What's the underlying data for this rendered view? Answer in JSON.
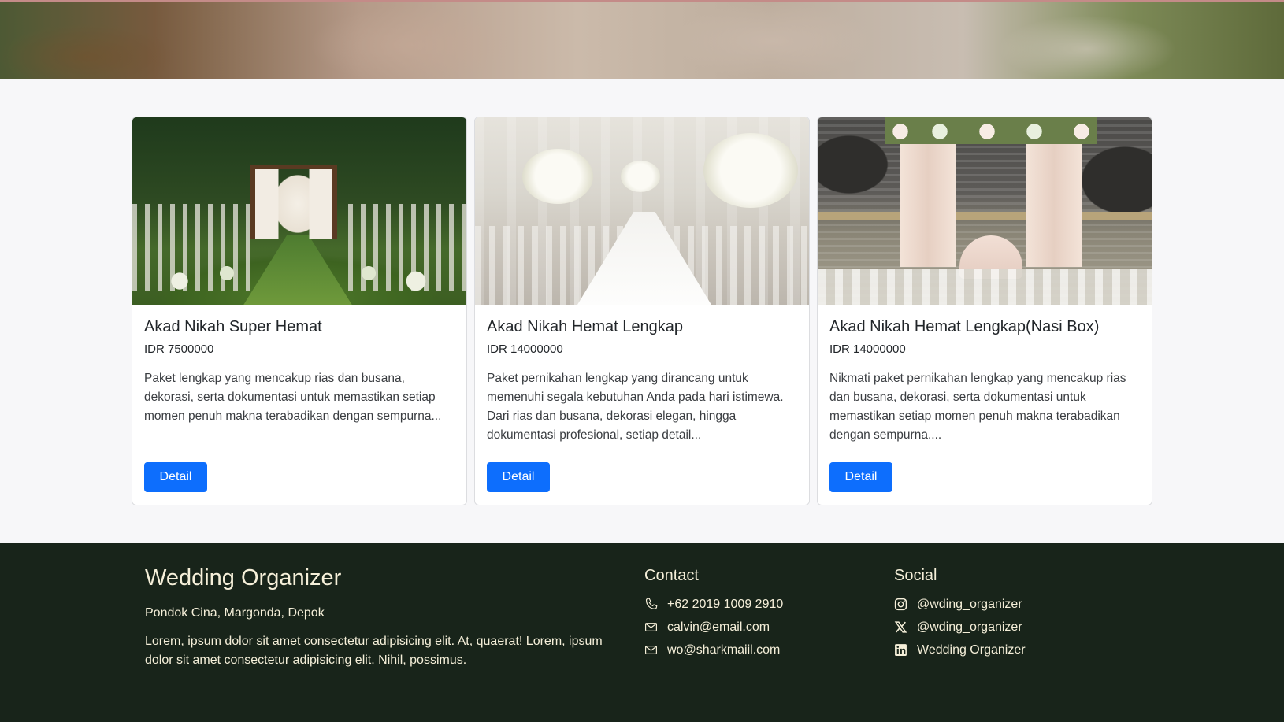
{
  "cards": [
    {
      "title": "Akad Nikah Super Hemat",
      "price": "IDR 7500000",
      "description": "Paket lengkap yang mencakup rias dan busana, dekorasi, serta dokumentasi untuk memastikan setiap momen penuh makna terabadikan dengan sempurna...",
      "button": "Detail"
    },
    {
      "title": "Akad Nikah Hemat Lengkap",
      "price": "IDR 14000000",
      "description": "Paket pernikahan lengkap yang dirancang untuk memenuhi segala kebutuhan Anda pada hari istimewa. Dari rias dan busana, dekorasi elegan, hingga dokumentasi profesional, setiap detail...",
      "button": "Detail"
    },
    {
      "title": "Akad Nikah Hemat Lengkap(Nasi Box)",
      "price": "IDR 14000000",
      "description": "Nikmati paket pernikahan lengkap yang mencakup rias dan busana, dekorasi, serta dokumentasi untuk memastikan setiap momen penuh makna terabadikan dengan sempurna....",
      "button": "Detail"
    }
  ],
  "footer": {
    "brand": "Wedding Organizer",
    "address": "Pondok Cina, Margonda, Depok",
    "text": "Lorem, ipsum dolor sit amet consectetur adipisicing elit. At, quaerat! Lorem, ipsum dolor sit amet consectetur adipisicing elit. Nihil, possimus.",
    "contact": {
      "title": "Contact",
      "phone": "+62 2019 1009 2910",
      "email1": "calvin@email.com",
      "email2": "wo@sharkmaiil.com"
    },
    "social": {
      "title": "Social",
      "instagram": "@wding_organizer",
      "x": "@wding_organizer",
      "linkedin": "Wedding Organizer"
    }
  },
  "colors": {
    "primary_button": "#0d6efd",
    "footer_bg": "#18241a",
    "footer_text": "#f5efd9"
  }
}
